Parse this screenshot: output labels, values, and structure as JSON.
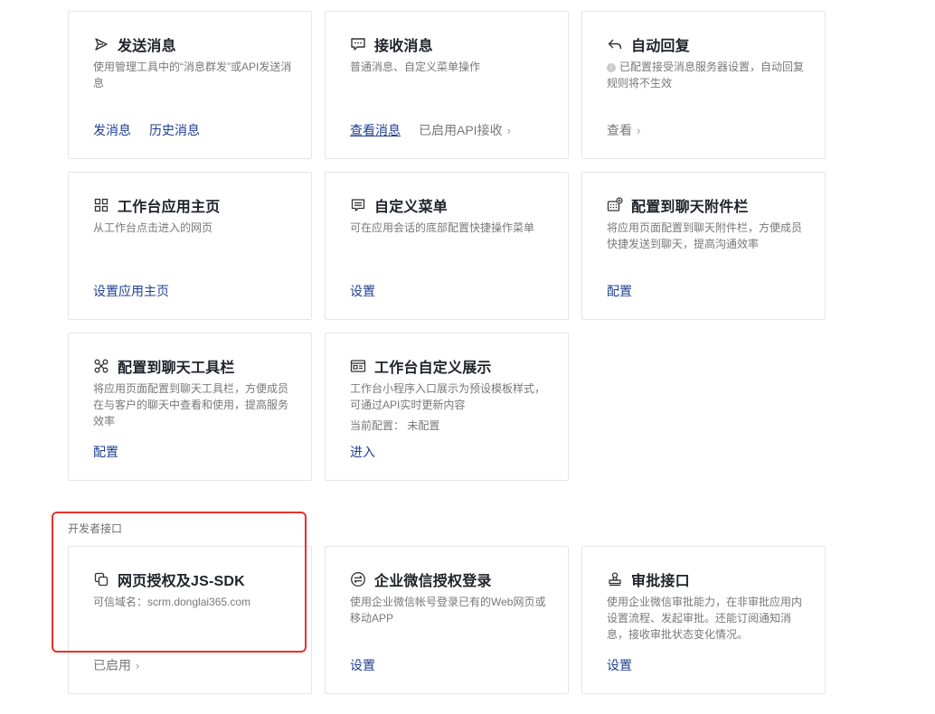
{
  "cards": [
    {
      "title": "发送消息",
      "icon": "send-icon",
      "desc": "使用管理工具中的“消息群发”或API发送消息",
      "actions": [
        {
          "label": "发消息"
        },
        {
          "label": "历史消息"
        }
      ]
    },
    {
      "title": "接收消息",
      "icon": "chat-bubble-icon",
      "desc": "普通消息、自定义菜单操作",
      "actions": [
        {
          "label": "查看消息"
        },
        {
          "label": "已启用API接收"
        }
      ]
    },
    {
      "title": "自动回复",
      "icon": "reply-icon",
      "info": "i",
      "desc": "已配置接受消息服务器设置，自动回复规则将不生效",
      "actions": [
        {
          "label": "查看"
        }
      ]
    },
    {
      "title": "工作台应用主页",
      "icon": "grid-icon",
      "desc": "从工作台点击进入的网页",
      "actions": [
        {
          "label": "设置应用主页"
        }
      ]
    },
    {
      "title": "自定义菜单",
      "icon": "menu-icon",
      "desc": "可在应用会话的底部配置快捷操作菜单",
      "actions": [
        {
          "label": "设置"
        }
      ]
    },
    {
      "title": "配置到聊天附件栏",
      "icon": "keyboard-plus-icon",
      "desc": "将应用页面配置到聊天附件栏，方便成员快捷发送到聊天，提高沟通效率",
      "actions": [
        {
          "label": "配置"
        }
      ]
    },
    {
      "title": "配置到聊天工具栏",
      "icon": "toolbar-icon",
      "desc": "将应用页面配置到聊天工具栏，方便成员在与客户的聊天中查看和使用，提高服务效率",
      "actions": [
        {
          "label": "配置"
        }
      ]
    },
    {
      "title": "工作台自定义展示",
      "icon": "id-card-icon",
      "desc": "工作台小程序入口展示为预设模板样式，可通过API实时更新内容",
      "sub": "当前配置： 未配置",
      "actions": [
        {
          "label": "进入"
        }
      ]
    },
    {
      "title": "网页授权及JS-SDK",
      "icon": "copy-icon",
      "desc": "可信域名：scrm.donglai365.com",
      "actions": [
        {
          "label": "已启用"
        }
      ]
    },
    {
      "title": "企业微信授权登录",
      "icon": "swap-icon",
      "desc": "使用企业微信帐号登录已有的Web网页或移动APP",
      "actions": [
        {
          "label": "设置"
        }
      ]
    },
    {
      "title": "审批接口",
      "icon": "stamp-icon",
      "desc": "使用企业微信审批能力，在非审批应用内设置流程、发起审批。还能订阅通知消息，接收审批状态变化情况。",
      "actions": [
        {
          "label": "设置"
        }
      ]
    }
  ],
  "section": {
    "developer_label": "开发者接口"
  },
  "colors": {
    "link": "#1f3f8f",
    "highlight": "#e5322d",
    "border": "#e4e6e9",
    "muted": "#787878"
  }
}
